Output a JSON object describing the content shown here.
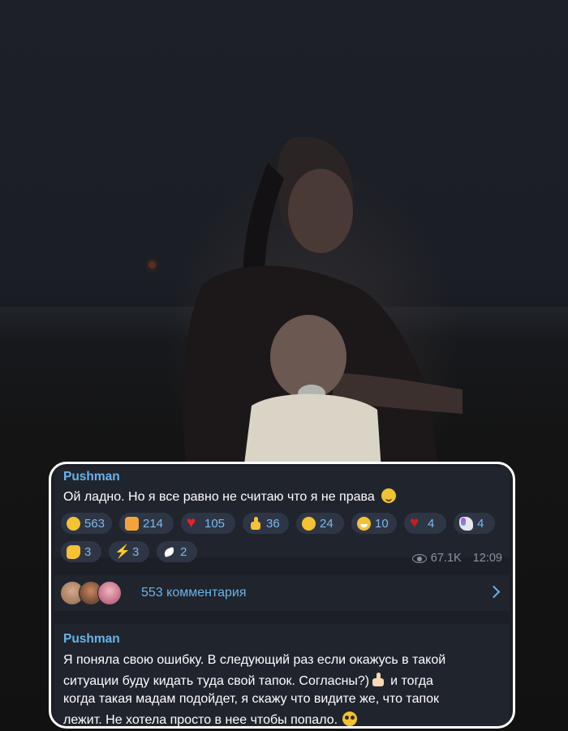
{
  "post": {
    "author": "Pushman",
    "text": "Ой ладно. Но я все равно не считаю что я не права",
    "text_emoji": "upside-down-face-icon",
    "reactions": [
      {
        "icon": "rolling-laughing-icon",
        "count": "563"
      },
      {
        "icon": "exploding-head-icon",
        "count": "214"
      },
      {
        "icon": "red-heart-icon",
        "count": "105"
      },
      {
        "icon": "thumbs-up-icon",
        "count": "36"
      },
      {
        "icon": "thinking-face-icon",
        "count": "24"
      },
      {
        "icon": "grinning-face-icon",
        "count": "10"
      },
      {
        "icon": "broken-heart-icon",
        "count": "4"
      },
      {
        "icon": "unicorn-icon",
        "count": "4"
      },
      {
        "icon": "clapping-hands-icon",
        "count": "3"
      },
      {
        "icon": "lightning-icon",
        "count": "3"
      },
      {
        "icon": "dove-icon",
        "count": "2"
      }
    ],
    "views": "67.1K",
    "time": "12:09"
  },
  "comments": {
    "label": "553 комментария"
  },
  "reply": {
    "author": "Pushman",
    "lines": [
      "Я поняла свою ошибку. В следующий раз если окажусь в такой",
      "ситуации буду кидать туда свой тапок. Согласны?)",
      "и тогда",
      "когда такая мадам подойдет, я скажу что видите же, что тапок",
      "лежит. Не хотела просто в нее чтобы попало."
    ]
  },
  "colors": {
    "accent": "#6ab3e9",
    "card_bg": "#20242d",
    "reaction_bg": "#2e3645",
    "frame": "#ffffff"
  }
}
